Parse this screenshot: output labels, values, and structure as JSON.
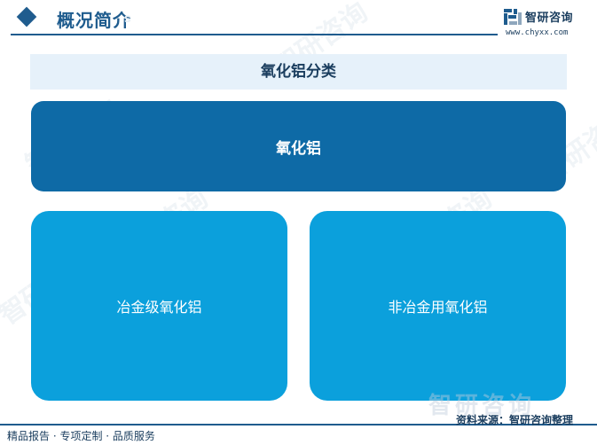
{
  "header": {
    "title": "概况简介",
    "title_ghost": "s",
    "brand_name": "智研咨询",
    "brand_url": "www.chyxx.com"
  },
  "diagram": {
    "section_title": "氧化铝分类",
    "root": "氧化铝",
    "children": [
      "冶金级氧化铝",
      "非冶金用氧化铝"
    ]
  },
  "watermark": "智研咨询",
  "footer": {
    "left": "精品报告 · 专项定制 · 品质服务",
    "source": "资料来源：智研咨询整理",
    "logo_text": "智研咨询"
  },
  "colors": {
    "header_accent": "#1f5c8e",
    "root_box": "#0e6aa6",
    "child_box": "#0ba0dc",
    "title_bar": "#e6f1fa"
  }
}
